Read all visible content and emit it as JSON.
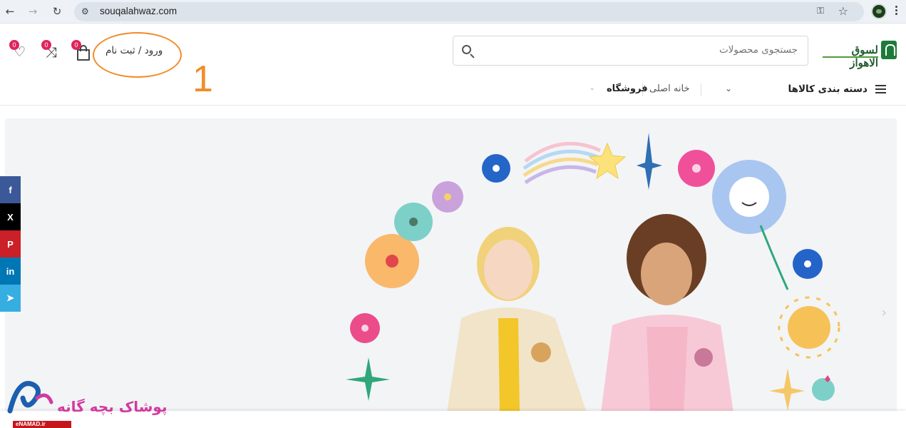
{
  "browser": {
    "url": "souqalahwaz.com"
  },
  "site": {
    "logo_text": "لسوق الاهواز"
  },
  "search": {
    "placeholder": "جستجوی محصولات"
  },
  "header": {
    "login_label": "ورود / ثبت نام",
    "cart_count": "0",
    "compare_count": "0",
    "wishlist_count": "0"
  },
  "annotation": {
    "number": "1",
    "color": "#f28c28"
  },
  "menu": {
    "categories_label": "دسته بندی کالاها",
    "home_label": "خانه اصلی",
    "shop_label": "فروشگاه"
  },
  "social": {
    "facebook": "f",
    "x": "X",
    "pinterest": "P",
    "linkedin": "in",
    "telegram": "➤"
  },
  "watermark": {
    "text": "پوشاک بچه گانه",
    "enamad": "eNAMAD.ir"
  },
  "colors": {
    "accent_badge": "#e0245e",
    "brand_green": "#1f7a3a",
    "facebook": "#3b5998",
    "pinterest": "#cb2027",
    "linkedin": "#0077b5",
    "telegram": "#37aee2"
  }
}
